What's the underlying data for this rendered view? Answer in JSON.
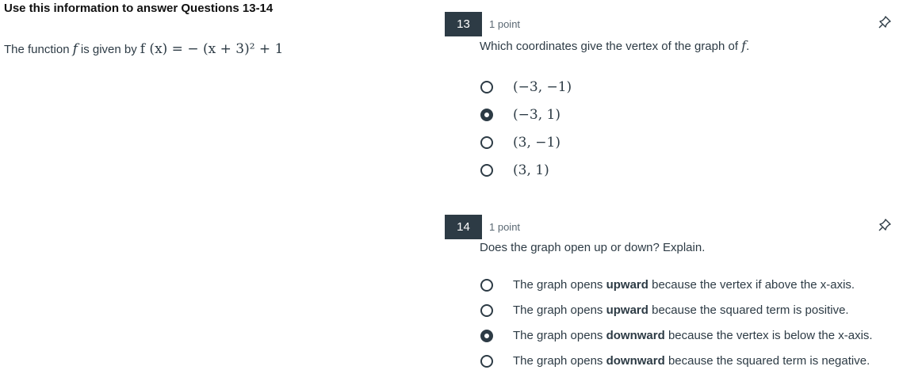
{
  "stimulus": {
    "title": "Use this information to answer Questions 13-14",
    "text_prefix": "The function",
    "func_name": "f",
    "text_middle": "is given by",
    "equation": "f (x) = − (x + 3)² + 1"
  },
  "questions": [
    {
      "number": "13",
      "points": "1 point",
      "prompt": "Which coordinates give the vertex of the graph of",
      "prompt_var": "f",
      "prompt_end": ".",
      "options": [
        {
          "label": "(−3, −1)",
          "selected": false
        },
        {
          "label": "(−3, 1)",
          "selected": true
        },
        {
          "label": "(3, −1)",
          "selected": false
        },
        {
          "label": "(3, 1)",
          "selected": false
        }
      ]
    },
    {
      "number": "14",
      "points": "1 point",
      "prompt": "Does the graph open up or down? Explain.",
      "options": [
        {
          "pre": "The graph opens",
          "bold": "upward",
          "post": "because the vertex if above the x-axis.",
          "selected": false
        },
        {
          "pre": "The graph opens",
          "bold": "upward",
          "post": "because the squared term is positive.",
          "selected": false
        },
        {
          "pre": "The graph opens",
          "bold": "downward",
          "post": "because the vertex is below the x-axis.",
          "selected": true
        },
        {
          "pre": "The graph opens",
          "bold": "downward",
          "post": "because the squared term is negative.",
          "selected": false
        }
      ]
    }
  ],
  "icons": {
    "pin": "pin-icon"
  },
  "colors": {
    "badge": "#2d3b45",
    "text": "#2d3b45"
  }
}
